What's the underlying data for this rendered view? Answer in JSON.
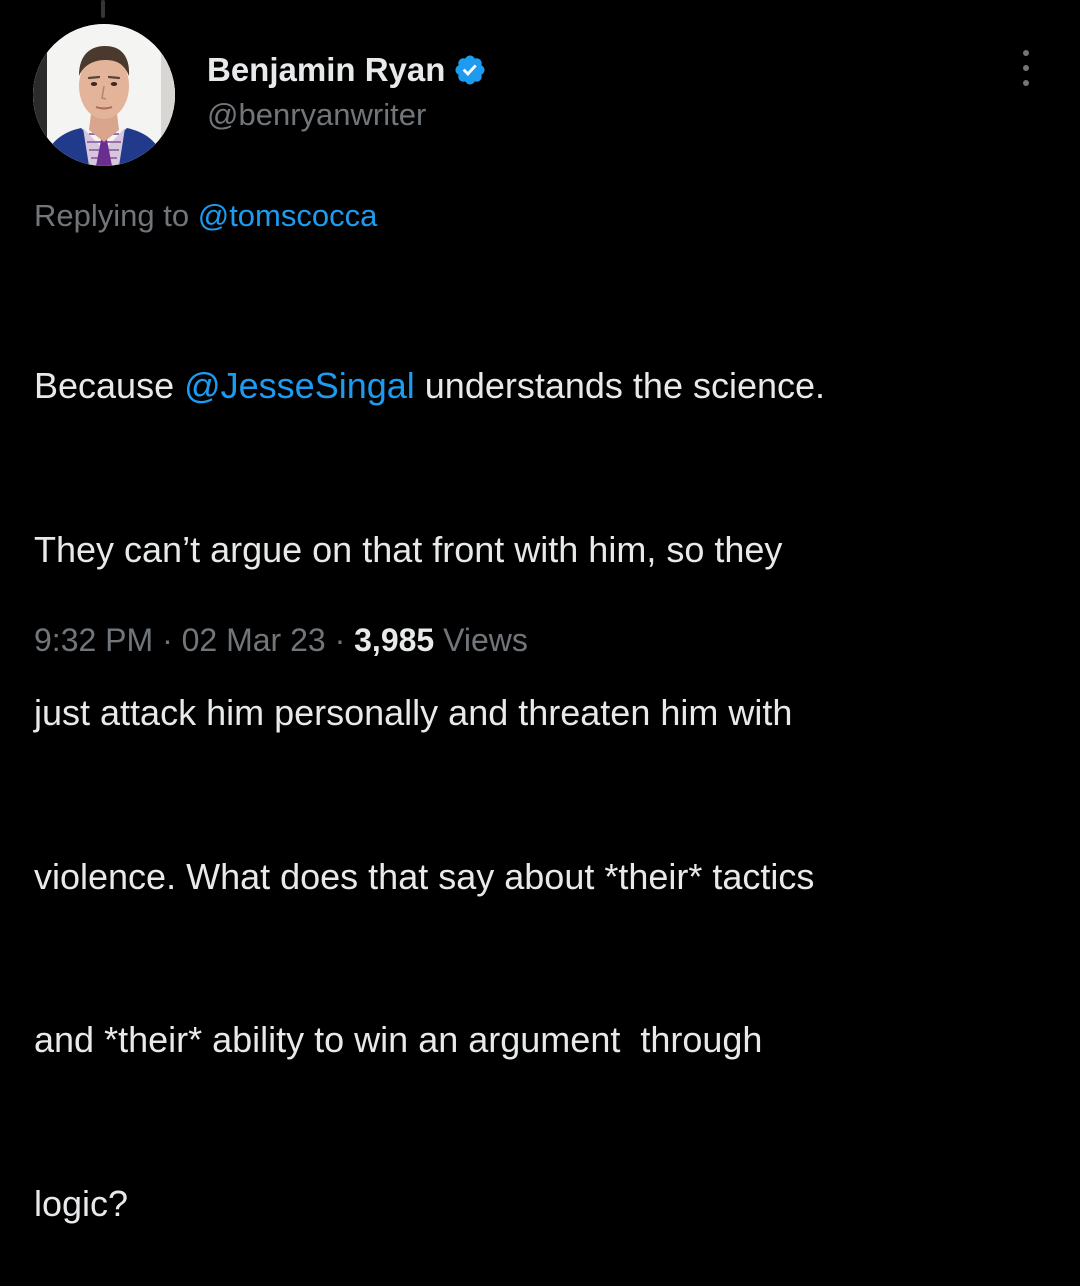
{
  "author": {
    "display_name": "Benjamin Ryan",
    "handle": "@benryanwriter",
    "verified": true,
    "avatar_icon": "profile-photo-avatar"
  },
  "reply": {
    "prefix": "Replying to ",
    "mention": "@tomscocca"
  },
  "tweet": {
    "lines": [
      {
        "before": "Because ",
        "mention": "@JesseSingal",
        "after": " understands the science."
      },
      {
        "text": "They can’t argue on that front with him, so they"
      },
      {
        "text": "just attack him personally and threaten him with"
      },
      {
        "text": "violence. What does that say about *their* tactics"
      },
      {
        "text": "and *their* ability to win an argument  through"
      },
      {
        "text": "logic?"
      }
    ]
  },
  "meta": {
    "time": "9:32 PM",
    "separator": " · ",
    "date": "02 Mar 23",
    "views_count": "3,985",
    "views_label": " Views"
  },
  "colors": {
    "background": "#000000",
    "text": "#e7e9ea",
    "secondary": "#71767b",
    "accent": "#1d9bf0"
  },
  "icons": {
    "verified": "verified-badge-icon",
    "more": "more-options-icon"
  }
}
